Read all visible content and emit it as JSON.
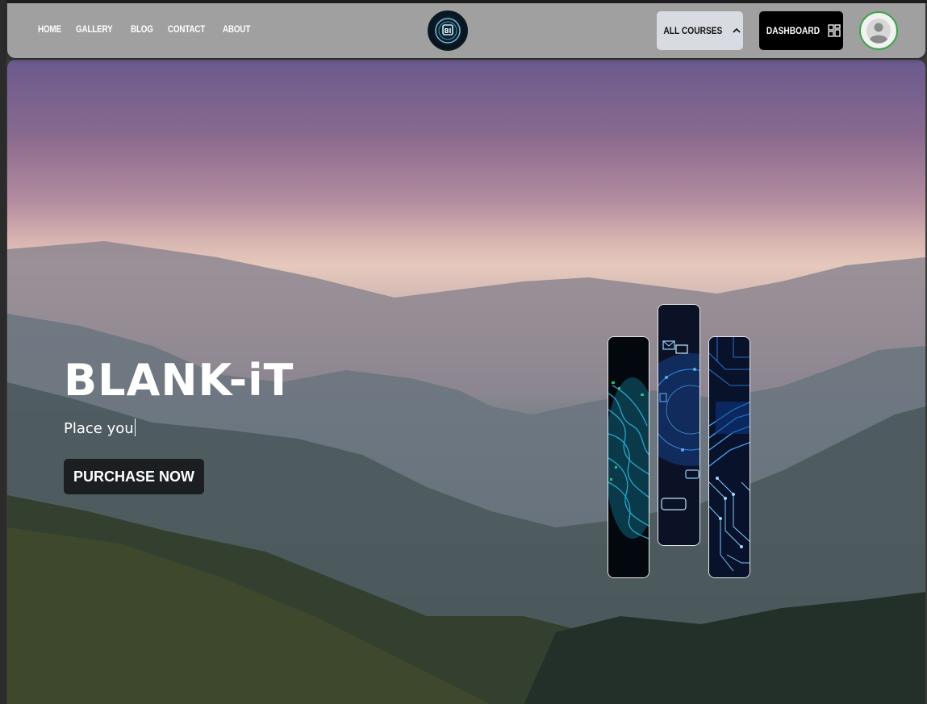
{
  "nav": {
    "links": [
      "HOME",
      "GALLERY",
      "BLOG",
      "CONTACT",
      "ABOUT"
    ],
    "courses_label": "ALL COURSES",
    "dashboard_label": "DASHBOARD",
    "logo_letters": "BI"
  },
  "hero": {
    "title": "BLANK-iT",
    "typed_text": "Place you",
    "cta_label": "PURCHASE NOW"
  },
  "icons": {
    "courses": "chevron-up-icon",
    "dashboard": "grid-icon",
    "profile": "user-icon"
  },
  "colors": {
    "navbar_bg": "#a0a0a0",
    "courses_btn_bg": "#d9dbe2",
    "dashboard_btn_bg": "#000000",
    "avatar_ring": "#3fa34d",
    "cta_bg": "#1b1f22"
  }
}
